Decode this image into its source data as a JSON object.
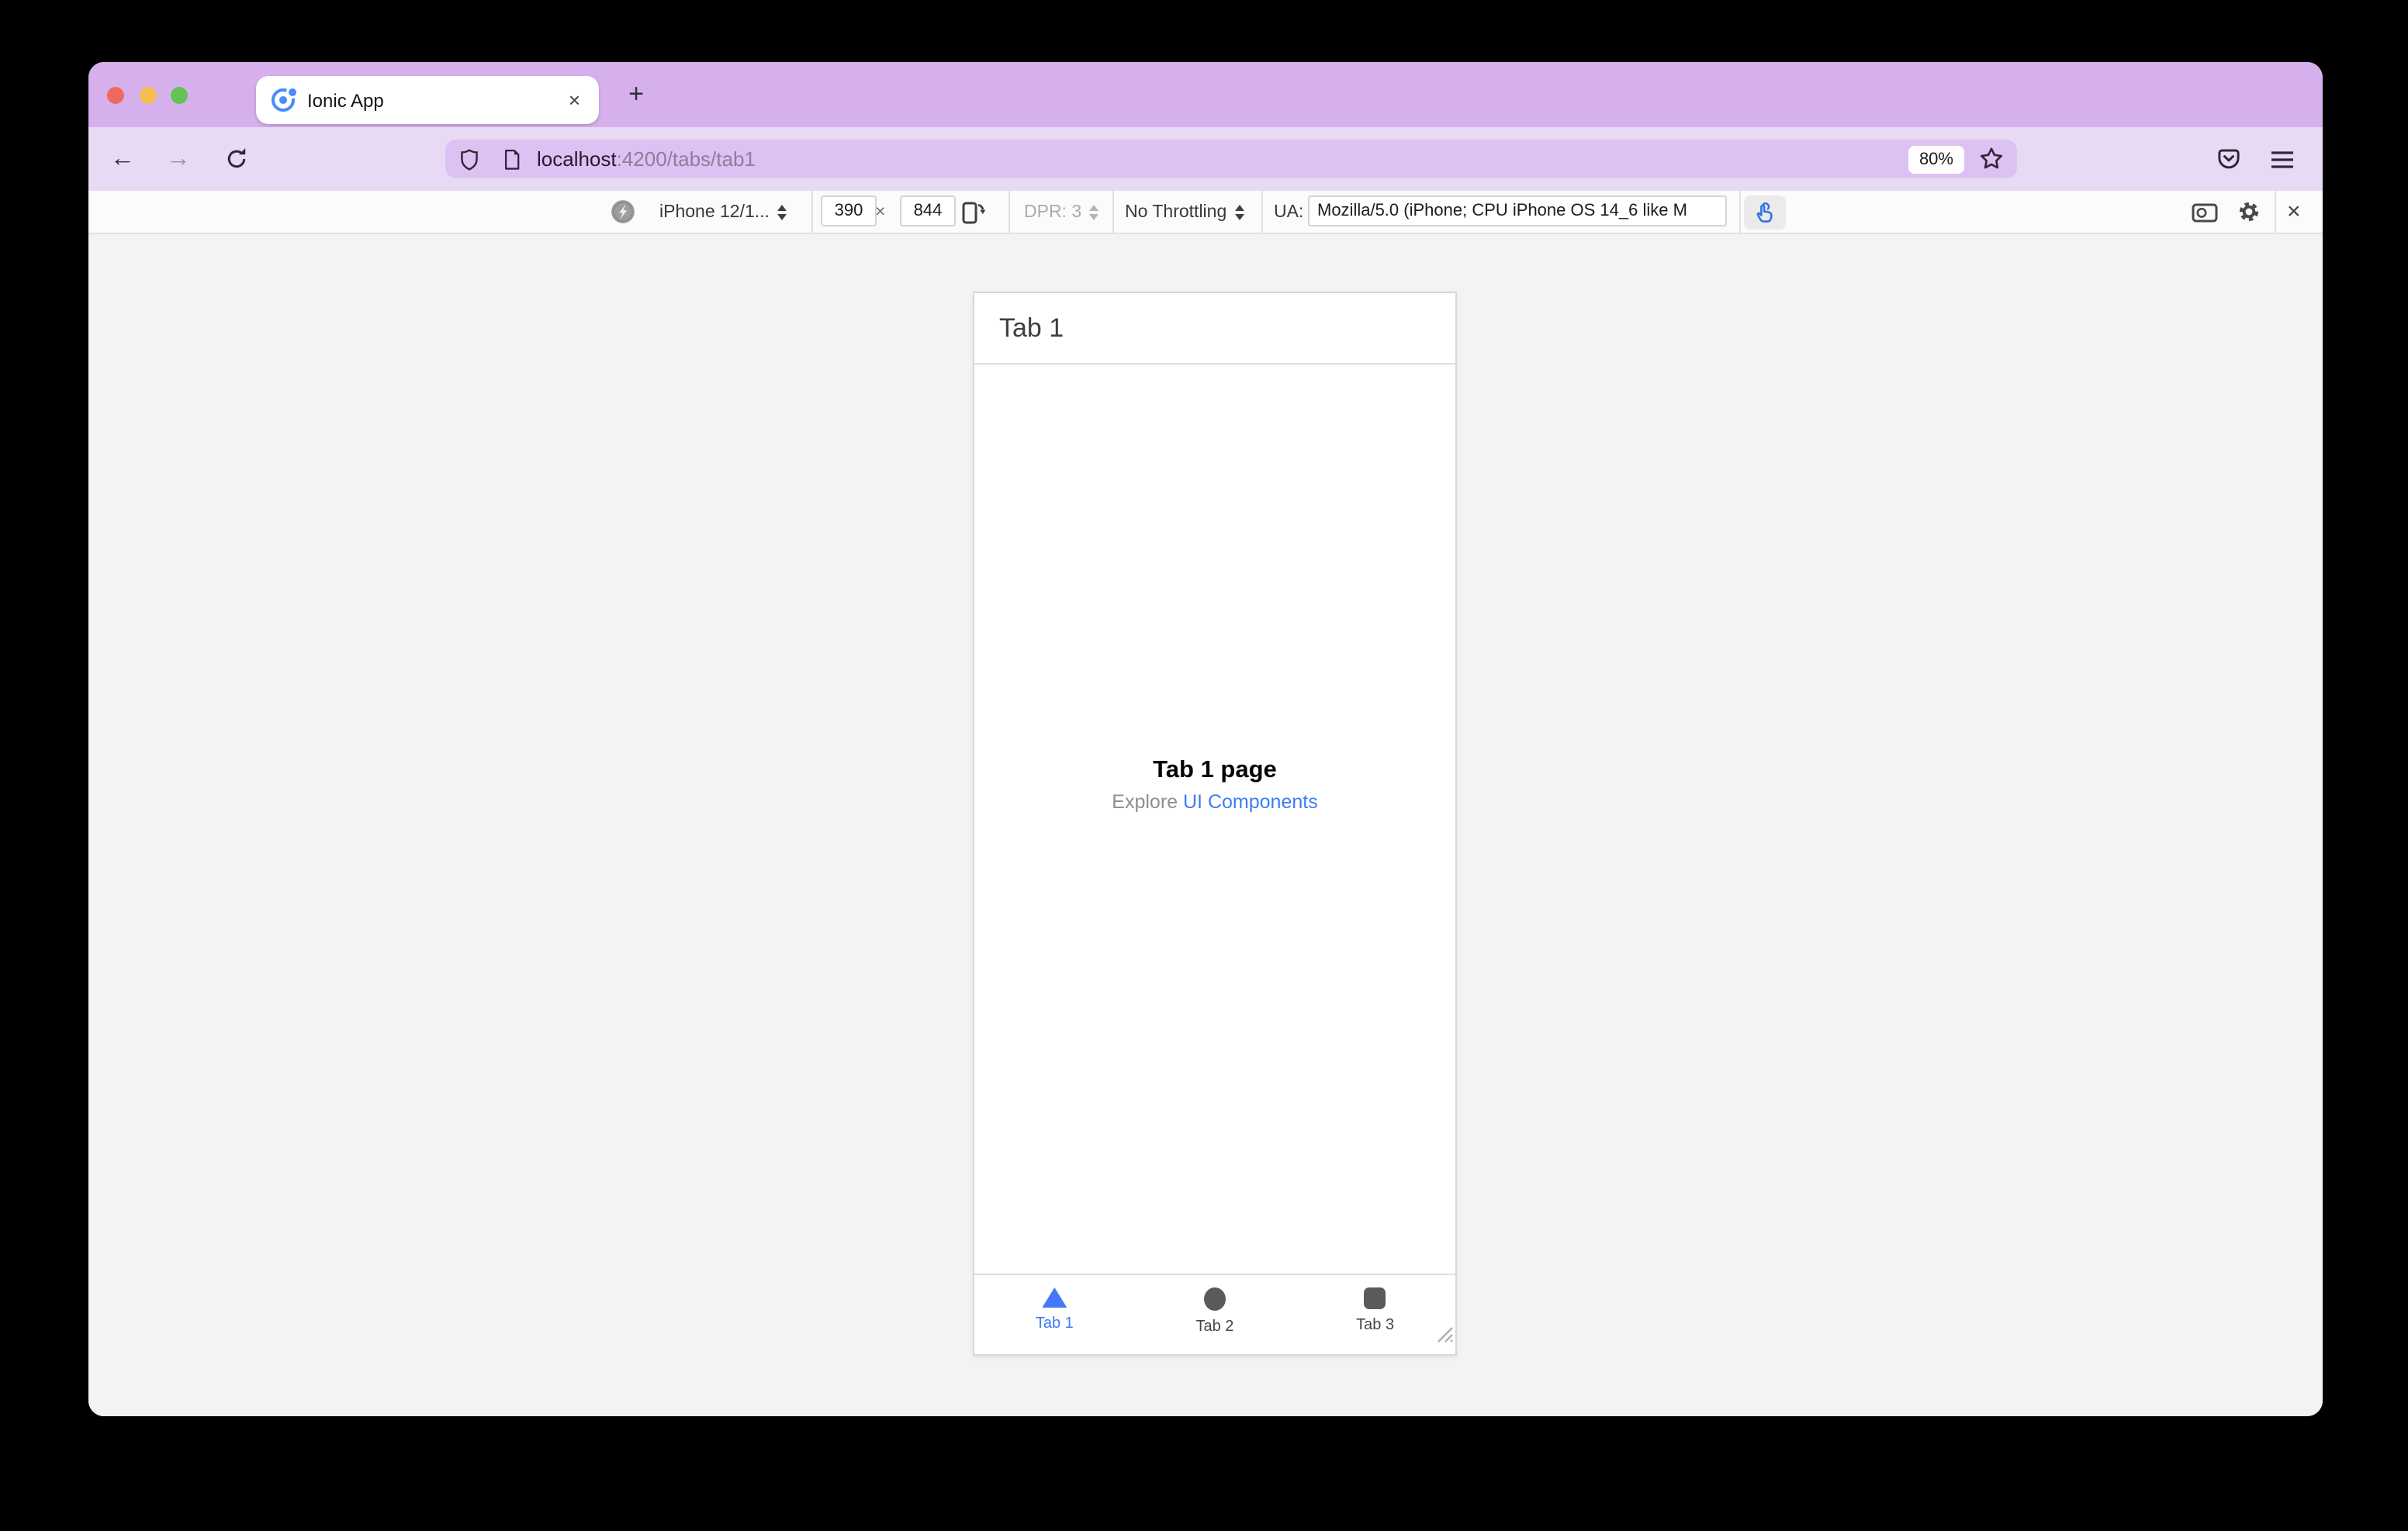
{
  "window": {
    "traffic_lights": {
      "close_color": "#ee6a5f",
      "minimize_color": "#f5bd4f",
      "zoom_color": "#61c454"
    },
    "theme": {
      "titlebar": "#d6b0ec",
      "toolbar": "#e8daf5",
      "urlbar": "#dcc2f3"
    }
  },
  "browser_tab": {
    "title": "Ionic App",
    "close_glyph": "×",
    "new_tab_glyph": "+"
  },
  "navbar": {
    "back_glyph": "←",
    "forward_glyph": "→",
    "url_host": "localhost",
    "url_rest": ":4200/tabs/tab1",
    "zoom_badge": "80%"
  },
  "rdm_toolbar": {
    "device": "iPhone 12/1...",
    "viewport_width": "390",
    "times_glyph": "×",
    "viewport_height": "844",
    "dpr": "DPR: 3",
    "throttling": "No Throttling",
    "ua_label": "UA:",
    "ua_value": "Mozilla/5.0 (iPhone; CPU iPhone OS 14_6 like M",
    "close_glyph": "×"
  },
  "phone": {
    "header_title": "Tab 1",
    "page_title": "Tab 1 page",
    "explore_prefix": "Explore ",
    "explore_link": "UI Components",
    "tabs": [
      {
        "label": "Tab 1",
        "icon": "triangle",
        "active": true
      },
      {
        "label": "Tab 2",
        "icon": "circle",
        "active": false
      },
      {
        "label": "Tab 3",
        "icon": "square",
        "active": false
      }
    ],
    "accent_color": "#4478f7",
    "link_color": "#3d7df5"
  }
}
